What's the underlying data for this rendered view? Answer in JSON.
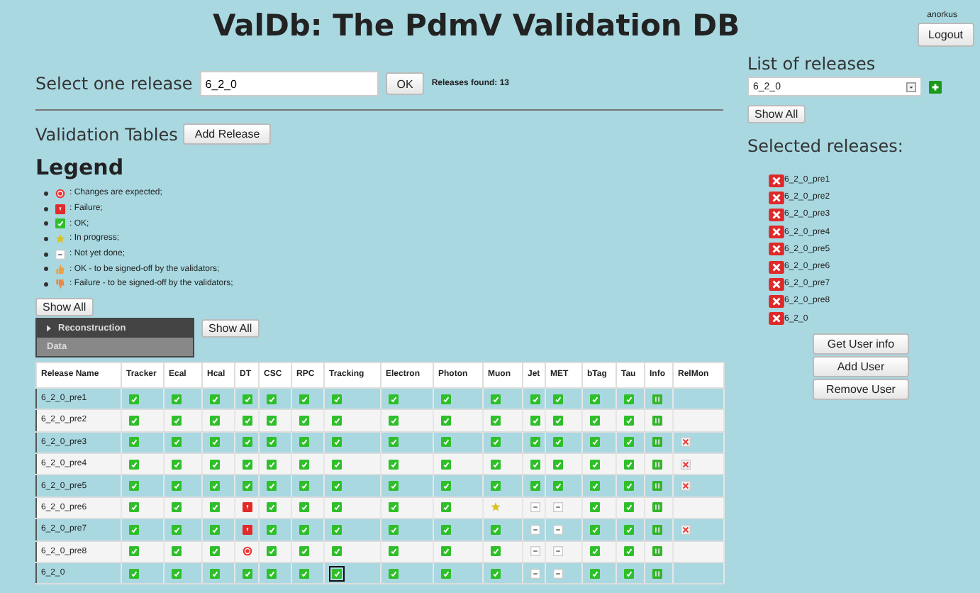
{
  "title": "ValDb: The PdmV Validation DB",
  "user": {
    "name": "anorkus",
    "logout": "Logout"
  },
  "select": {
    "label": "Select one release",
    "value": "6_2_0",
    "button": "OK",
    "found": "Releases found: 13"
  },
  "validation": {
    "label": "Validation Tables",
    "button": "Add Release"
  },
  "legend": {
    "title": "Legend",
    "items": [
      {
        "kind": "changes",
        "text": ": Changes are expected;"
      },
      {
        "kind": "fail",
        "text": ": Failure;"
      },
      {
        "kind": "ok",
        "text": ": OK;"
      },
      {
        "kind": "progress",
        "text": ": In progress;"
      },
      {
        "kind": "notdone",
        "text": ": Not yet done;"
      },
      {
        "kind": "thumbup",
        "text": ": OK - to be signed-off by the validators;"
      },
      {
        "kind": "thumbdown",
        "text": ": Failure - to be signed-off by the validators;"
      }
    ]
  },
  "show_all": "Show All",
  "tabs": [
    {
      "label": "Reconstruction",
      "selected": true
    },
    {
      "label": "Data",
      "selected": false
    }
  ],
  "tabs_show_all": "Show All",
  "table": {
    "columns": [
      "Release Name",
      "Tracker",
      "Ecal",
      "Hcal",
      "DT",
      "CSC",
      "RPC",
      "Tracking",
      "Electron",
      "Photon",
      "Muon",
      "Jet",
      "MET",
      "bTag",
      "Tau",
      "Info",
      "RelMon"
    ],
    "rows": [
      {
        "name": "6_2_0_pre1",
        "cells": [
          {
            "kind": "ok",
            "focused": false
          },
          {
            "kind": "ok",
            "focused": false
          },
          {
            "kind": "ok",
            "focused": false
          },
          {
            "kind": "ok",
            "focused": false
          },
          {
            "kind": "ok",
            "focused": false
          },
          {
            "kind": "ok",
            "focused": false
          },
          {
            "kind": "ok",
            "focused": false
          },
          {
            "kind": "ok",
            "focused": false
          },
          {
            "kind": "ok",
            "focused": false
          },
          {
            "kind": "ok",
            "focused": false
          },
          {
            "kind": "ok",
            "focused": false
          },
          {
            "kind": "ok",
            "focused": false
          },
          {
            "kind": "ok",
            "focused": false
          },
          {
            "kind": "ok",
            "focused": false
          },
          {
            "kind": "info",
            "focused": false
          },
          {
            "kind": "none",
            "focused": false
          }
        ]
      },
      {
        "name": "6_2_0_pre2",
        "cells": [
          {
            "kind": "ok",
            "focused": false
          },
          {
            "kind": "ok",
            "focused": false
          },
          {
            "kind": "ok",
            "focused": false
          },
          {
            "kind": "ok",
            "focused": false
          },
          {
            "kind": "ok",
            "focused": false
          },
          {
            "kind": "ok",
            "focused": false
          },
          {
            "kind": "ok",
            "focused": false
          },
          {
            "kind": "ok",
            "focused": false
          },
          {
            "kind": "ok",
            "focused": false
          },
          {
            "kind": "ok",
            "focused": false
          },
          {
            "kind": "ok",
            "focused": false
          },
          {
            "kind": "ok",
            "focused": false
          },
          {
            "kind": "ok",
            "focused": false
          },
          {
            "kind": "ok",
            "focused": false
          },
          {
            "kind": "info",
            "focused": false
          },
          {
            "kind": "none",
            "focused": false
          }
        ]
      },
      {
        "name": "6_2_0_pre3",
        "cells": [
          {
            "kind": "ok",
            "focused": false
          },
          {
            "kind": "ok",
            "focused": false
          },
          {
            "kind": "ok",
            "focused": false
          },
          {
            "kind": "ok",
            "focused": false
          },
          {
            "kind": "ok",
            "focused": false
          },
          {
            "kind": "ok",
            "focused": false
          },
          {
            "kind": "ok",
            "focused": false
          },
          {
            "kind": "ok",
            "focused": false
          },
          {
            "kind": "ok",
            "focused": false
          },
          {
            "kind": "ok",
            "focused": false
          },
          {
            "kind": "ok",
            "focused": false
          },
          {
            "kind": "ok",
            "focused": false
          },
          {
            "kind": "ok",
            "focused": false
          },
          {
            "kind": "ok",
            "focused": false
          },
          {
            "kind": "info",
            "focused": false
          },
          {
            "kind": "remove",
            "focused": false
          }
        ]
      },
      {
        "name": "6_2_0_pre4",
        "cells": [
          {
            "kind": "ok",
            "focused": false
          },
          {
            "kind": "ok",
            "focused": false
          },
          {
            "kind": "ok",
            "focused": false
          },
          {
            "kind": "ok",
            "focused": false
          },
          {
            "kind": "ok",
            "focused": false
          },
          {
            "kind": "ok",
            "focused": false
          },
          {
            "kind": "ok",
            "focused": false
          },
          {
            "kind": "ok",
            "focused": false
          },
          {
            "kind": "ok",
            "focused": false
          },
          {
            "kind": "ok",
            "focused": false
          },
          {
            "kind": "ok",
            "focused": false
          },
          {
            "kind": "ok",
            "focused": false
          },
          {
            "kind": "ok",
            "focused": false
          },
          {
            "kind": "ok",
            "focused": false
          },
          {
            "kind": "info",
            "focused": false
          },
          {
            "kind": "remove",
            "focused": false
          }
        ]
      },
      {
        "name": "6_2_0_pre5",
        "cells": [
          {
            "kind": "ok",
            "focused": false
          },
          {
            "kind": "ok",
            "focused": false
          },
          {
            "kind": "ok",
            "focused": false
          },
          {
            "kind": "ok",
            "focused": false
          },
          {
            "kind": "ok",
            "focused": false
          },
          {
            "kind": "ok",
            "focused": false
          },
          {
            "kind": "ok",
            "focused": false
          },
          {
            "kind": "ok",
            "focused": false
          },
          {
            "kind": "ok",
            "focused": false
          },
          {
            "kind": "ok",
            "focused": false
          },
          {
            "kind": "ok",
            "focused": false
          },
          {
            "kind": "ok",
            "focused": false
          },
          {
            "kind": "ok",
            "focused": false
          },
          {
            "kind": "ok",
            "focused": false
          },
          {
            "kind": "info",
            "focused": false
          },
          {
            "kind": "remove",
            "focused": false
          }
        ]
      },
      {
        "name": "6_2_0_pre6",
        "cells": [
          {
            "kind": "ok",
            "focused": false
          },
          {
            "kind": "ok",
            "focused": false
          },
          {
            "kind": "ok",
            "focused": false
          },
          {
            "kind": "fail",
            "focused": false
          },
          {
            "kind": "ok",
            "focused": false
          },
          {
            "kind": "ok",
            "focused": false
          },
          {
            "kind": "ok",
            "focused": false
          },
          {
            "kind": "ok",
            "focused": false
          },
          {
            "kind": "ok",
            "focused": false
          },
          {
            "kind": "progress",
            "focused": false
          },
          {
            "kind": "notdone",
            "focused": false
          },
          {
            "kind": "notdone",
            "focused": false
          },
          {
            "kind": "ok",
            "focused": false
          },
          {
            "kind": "ok",
            "focused": false
          },
          {
            "kind": "info",
            "focused": false
          },
          {
            "kind": "none",
            "focused": false
          }
        ]
      },
      {
        "name": "6_2_0_pre7",
        "cells": [
          {
            "kind": "ok",
            "focused": false
          },
          {
            "kind": "ok",
            "focused": false
          },
          {
            "kind": "ok",
            "focused": false
          },
          {
            "kind": "fail",
            "focused": false
          },
          {
            "kind": "ok",
            "focused": false
          },
          {
            "kind": "ok",
            "focused": false
          },
          {
            "kind": "ok",
            "focused": false
          },
          {
            "kind": "ok",
            "focused": false
          },
          {
            "kind": "ok",
            "focused": false
          },
          {
            "kind": "ok",
            "focused": false
          },
          {
            "kind": "notdone",
            "focused": false
          },
          {
            "kind": "notdone",
            "focused": false
          },
          {
            "kind": "ok",
            "focused": false
          },
          {
            "kind": "ok",
            "focused": false
          },
          {
            "kind": "info",
            "focused": false
          },
          {
            "kind": "remove",
            "focused": false
          }
        ]
      },
      {
        "name": "6_2_0_pre8",
        "cells": [
          {
            "kind": "ok",
            "focused": false
          },
          {
            "kind": "ok",
            "focused": false
          },
          {
            "kind": "ok",
            "focused": false
          },
          {
            "kind": "changes",
            "focused": false
          },
          {
            "kind": "ok",
            "focused": false
          },
          {
            "kind": "ok",
            "focused": false
          },
          {
            "kind": "ok",
            "focused": false
          },
          {
            "kind": "ok",
            "focused": false
          },
          {
            "kind": "ok",
            "focused": false
          },
          {
            "kind": "ok",
            "focused": false
          },
          {
            "kind": "notdone",
            "focused": false
          },
          {
            "kind": "notdone",
            "focused": false
          },
          {
            "kind": "ok",
            "focused": false
          },
          {
            "kind": "ok",
            "focused": false
          },
          {
            "kind": "info",
            "focused": false
          },
          {
            "kind": "none",
            "focused": false
          }
        ]
      },
      {
        "name": "6_2_0",
        "cells": [
          {
            "kind": "ok",
            "focused": false
          },
          {
            "kind": "ok",
            "focused": false
          },
          {
            "kind": "ok",
            "focused": false
          },
          {
            "kind": "ok",
            "focused": false
          },
          {
            "kind": "ok",
            "focused": false
          },
          {
            "kind": "ok",
            "focused": false
          },
          {
            "kind": "ok",
            "focused": true
          },
          {
            "kind": "ok",
            "focused": false
          },
          {
            "kind": "ok",
            "focused": false
          },
          {
            "kind": "ok",
            "focused": false
          },
          {
            "kind": "notdone",
            "focused": false
          },
          {
            "kind": "notdone",
            "focused": false
          },
          {
            "kind": "ok",
            "focused": false
          },
          {
            "kind": "ok",
            "focused": false
          },
          {
            "kind": "info",
            "focused": false
          },
          {
            "kind": "none",
            "focused": false
          }
        ]
      }
    ]
  },
  "releases": {
    "title": "List of releases",
    "value": "6_2_0",
    "show_all": "Show All"
  },
  "selected_releases": {
    "title": "Selected releases:",
    "items": [
      "6_2_0_pre1",
      "6_2_0_pre2",
      "6_2_0_pre3",
      "6_2_0_pre4",
      "6_2_0_pre5",
      "6_2_0_pre6",
      "6_2_0_pre7",
      "6_2_0_pre8",
      "6_2_0"
    ]
  },
  "user_buttons": [
    "Get User info",
    "Add User",
    "Remove User"
  ]
}
